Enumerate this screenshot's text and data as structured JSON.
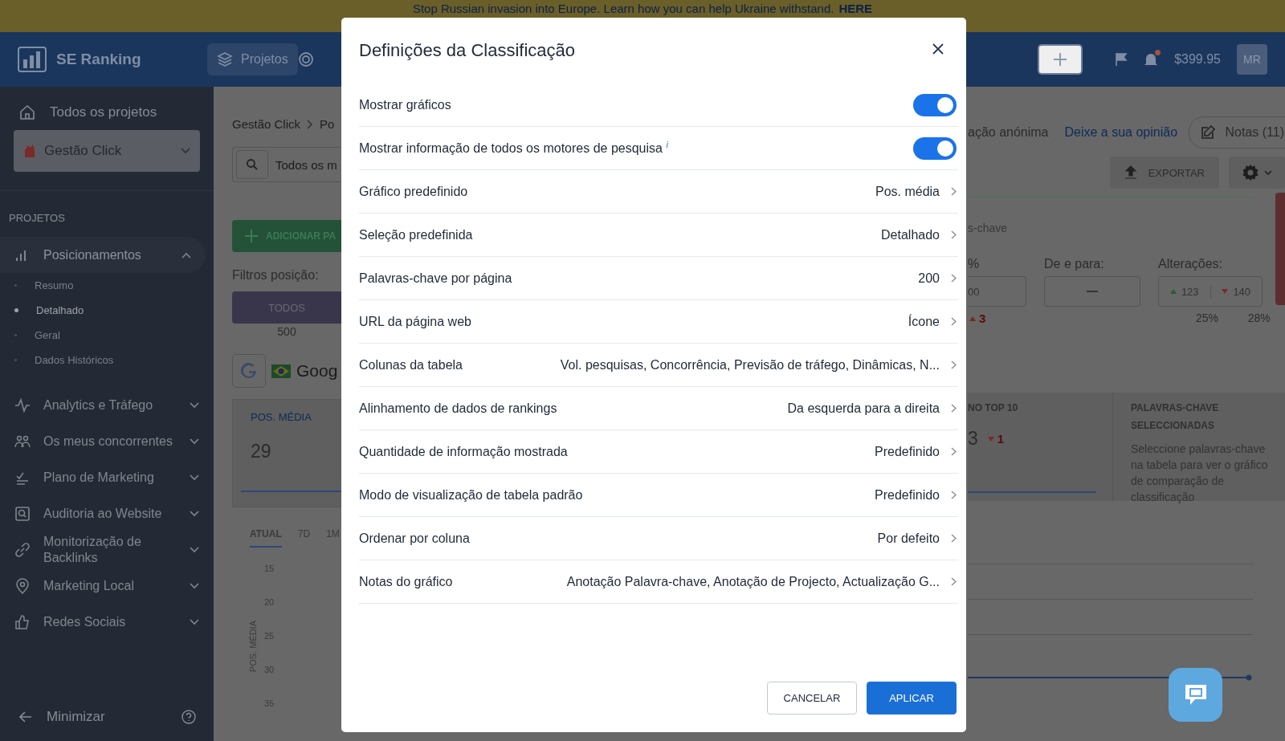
{
  "banner": {
    "text": "Stop Russian invasion into Europe. Learn how you can help Ukraine withstand.",
    "link": "HERE"
  },
  "header": {
    "logo": "SE Ranking",
    "nav": [
      {
        "label": "Projetos",
        "selected": true
      }
    ],
    "balance": "$399.95",
    "avatar": "MR",
    "notification": true
  },
  "sidebar": {
    "all_projects": "Todos os projetos",
    "project": "Gestão Click",
    "section": "PROJETOS",
    "items": [
      {
        "label": "Posicionamentos",
        "expanded": true,
        "children": [
          {
            "label": "Resumo",
            "selected": false
          },
          {
            "label": "Detalhado",
            "selected": true
          },
          {
            "label": "Geral",
            "selected": false
          },
          {
            "label": "Dados Históricos",
            "selected": false
          }
        ]
      },
      {
        "label": "Analytics e Tráfego",
        "expanded": false
      },
      {
        "label": "Os meus concorrentes",
        "expanded": false
      },
      {
        "label": "Plano de Marketing",
        "expanded": false
      },
      {
        "label": "Auditoria ao Website",
        "expanded": false
      },
      {
        "label": "Monitorização de Backlinks",
        "expanded": false
      },
      {
        "label": "Marketing Local",
        "expanded": false
      },
      {
        "label": "Redes Sociais",
        "expanded": false
      }
    ],
    "minimize": "Minimizar"
  },
  "main_left": {
    "breadcrumb": [
      "Gestão Click",
      "Po"
    ],
    "search": "Todos os m",
    "add_button": "ADICIONAR PA",
    "filters_label": "Filtros posição:",
    "filter": {
      "label": "TODOS",
      "selected": true
    },
    "filter_count": "500",
    "engine": "Goog",
    "card_title": "POS. MÉDIA",
    "card_value": "29",
    "periods": [
      {
        "label": "ATUAL",
        "selected": true
      },
      {
        "label": "7D",
        "selected": false
      },
      {
        "label": "1M",
        "selected": false
      }
    ],
    "y_ticks": [
      "15",
      "20",
      "25",
      "30",
      "35"
    ],
    "y_label": "POS. MÉDIA"
  },
  "main_right": {
    "anon": "ação anónima",
    "feedback": "Deixe a sua opinião",
    "notes": "Notas (11)",
    "export": "EXPORTAR",
    "keywords_tail": "s-chave",
    "percent_label": "%",
    "range_label": "De e para:",
    "changes_label": "Alterações:",
    "input_tail": "00",
    "delta_up": "3",
    "changes_up": "123",
    "changes_down": "140",
    "changes_up_pct": "25%",
    "changes_down_pct": "28%",
    "top_title": "NO TOP 10",
    "top_value": "3",
    "top_delta": "1",
    "selected_title": "PALAVRAS-CHAVE SELECCIONADAS",
    "selected_text": "Seleccione palavras-chave na tabela para ver o gráfico de comparação de classificação"
  },
  "modal": {
    "title": "Definições da Classificação",
    "rows": [
      {
        "kind": "toggle",
        "label": "Mostrar gráficos",
        "on": true
      },
      {
        "kind": "toggle",
        "label": "Mostrar informação de todos os motores de pesquisa $^{i}$",
        "on": true
      },
      {
        "kind": "select",
        "label": "Gráfico predefinido",
        "value": "Pos. média"
      },
      {
        "kind": "select",
        "label": "Seleção predefinida",
        "value": "Detalhado"
      },
      {
        "kind": "select",
        "label": "Palavras-chave por página",
        "value": "200"
      },
      {
        "kind": "select",
        "label": "URL da página web",
        "value": "Ícone"
      },
      {
        "kind": "select",
        "label": "Colunas da tabela",
        "value": "Vol. pesquisas, Concorrência, Previsão de tráfego, Dinâmicas, N..."
      },
      {
        "kind": "select",
        "label": "Alinhamento de dados de rankings",
        "value": "Da esquerda para a direita"
      },
      {
        "kind": "select",
        "label": "Quantidade de informação mostrada",
        "value": "Predefinido"
      },
      {
        "kind": "select",
        "label": "Modo de visualização de tabela padrão",
        "value": "Predefinido"
      },
      {
        "kind": "select",
        "label": "Ordenar por coluna",
        "value": "Por defeito"
      },
      {
        "kind": "select",
        "label": "Notas do gráfico",
        "value": "Anotação Palavra-chave, Anotação de Projecto, Actualização G..."
      }
    ],
    "buttons": [
      {
        "label": "CANCELAR",
        "kind": "secondary"
      },
      {
        "label": "APLICAR",
        "kind": "primary"
      }
    ]
  }
}
